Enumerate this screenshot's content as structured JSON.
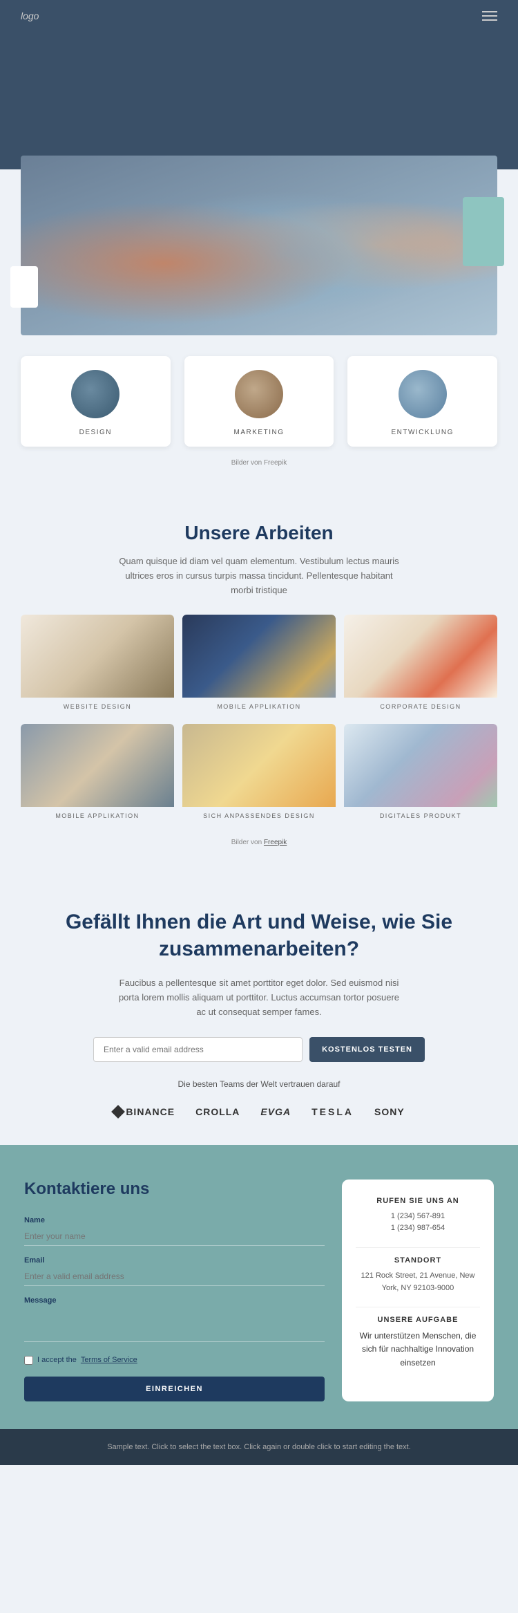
{
  "header": {
    "logo": "logo",
    "menu_icon": "☰"
  },
  "hero": {
    "freepik_credit": "Bilder von Freepik",
    "services": [
      {
        "label": "DESIGN",
        "circle_class": "circle-design"
      },
      {
        "label": "MARKETING",
        "circle_class": "circle-marketing"
      },
      {
        "label": "ENTWICKLUNG",
        "circle_class": "circle-entwicklung"
      }
    ]
  },
  "works": {
    "title": "Unsere Arbeiten",
    "description": "Quam quisque id diam vel quam elementum. Vestibulum lectus mauris ultrices eros in cursus turpis massa tincidunt. Pellentesque habitant morbi tristique",
    "freepik_credit": "Bilder von ",
    "freepik_link": "Freepik",
    "items": [
      {
        "label": "WEBSITE DESIGN",
        "img_class": "p-website"
      },
      {
        "label": "MOBILE APPLIKATION",
        "img_class": "p-mobile"
      },
      {
        "label": "CORPORATE DESIGN",
        "img_class": "p-corporate"
      },
      {
        "label": "MOBILE APPLIKATION",
        "img_class": "p-mobile2"
      },
      {
        "label": "SICH ANPASSENDES DESIGN",
        "img_class": "p-responsive"
      },
      {
        "label": "DIGITALES PRODUKT",
        "img_class": "p-digital"
      }
    ]
  },
  "cta": {
    "title": "Gefällt Ihnen die Art und Weise, wie Sie zusammenarbeiten?",
    "description": "Faucibus a pellentesque sit amet porttitor eget dolor. Sed euismod nisi porta lorem mollis aliquam ut porttitor. Luctus accumsan tortor posuere ac ut consequat semper fames.",
    "input_placeholder": "Enter a valid email address",
    "button_label": "KOSTENLOS TESTEN",
    "trust_text": "Die besten Teams der Welt vertrauen darauf",
    "brands": [
      {
        "name": "BINANCE",
        "type": "binance"
      },
      {
        "name": "CROLLA",
        "type": "text"
      },
      {
        "name": "EVGA",
        "type": "text"
      },
      {
        "name": "TESLA",
        "type": "text"
      },
      {
        "name": "SONY",
        "type": "text"
      }
    ]
  },
  "contact": {
    "title": "Kontaktiere uns",
    "fields": {
      "name_label": "Name",
      "name_placeholder": "Enter your name",
      "email_label": "Email",
      "email_placeholder": "Enter a valid email address",
      "message_label": "Message",
      "message_placeholder": ""
    },
    "checkbox_text": "I accept the ",
    "checkbox_link": "Terms of Service",
    "submit_label": "EINREICHEN",
    "info_card": {
      "phone_title": "RUFEN SIE UNS AN",
      "phone_1": "1 (234) 567-891",
      "phone_2": "1 (234) 987-654",
      "location_title": "STANDORT",
      "location_text": "121 Rock Street, 21 Avenue, New York, NY 92103-9000",
      "mission_title": "UNSERE AUFGABE",
      "mission_text": "Wir unterstützen Menschen, die sich für nachhaltige Innovation einsetzen"
    }
  },
  "footer": {
    "text": "Sample text. Click to select the text box. Click again or double click to start editing the text."
  }
}
